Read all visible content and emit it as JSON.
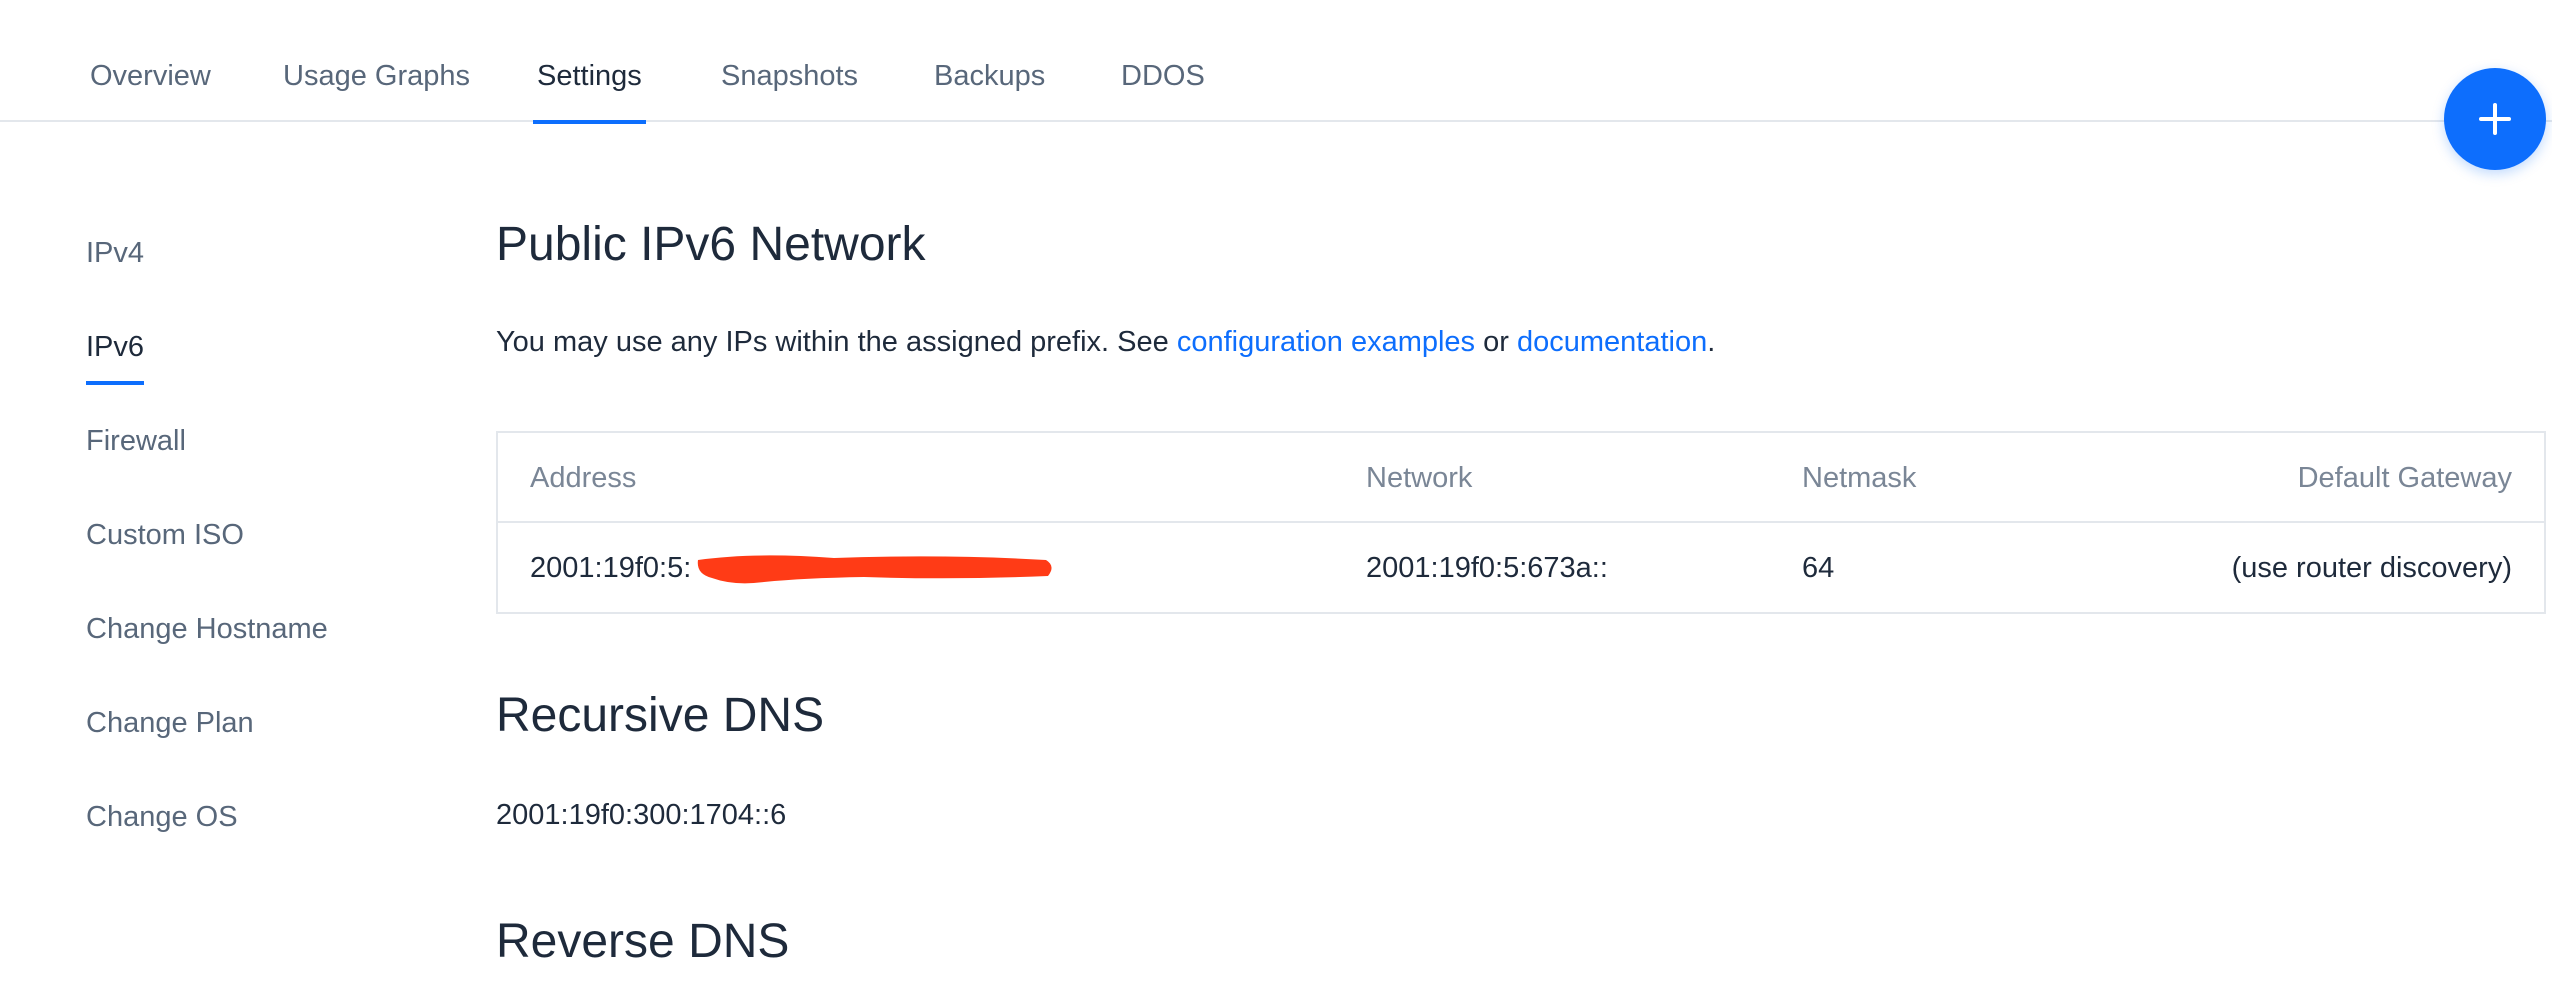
{
  "tabs": [
    {
      "label": "Overview"
    },
    {
      "label": "Usage Graphs"
    },
    {
      "label": "Settings",
      "active": true
    },
    {
      "label": "Snapshots"
    },
    {
      "label": "Backups"
    },
    {
      "label": "DDOS"
    }
  ],
  "fab": {
    "icon": "plus-icon"
  },
  "sidenav": [
    {
      "label": "IPv4"
    },
    {
      "label": "IPv6",
      "active": true
    },
    {
      "label": "Firewall"
    },
    {
      "label": "Custom ISO"
    },
    {
      "label": "Change Hostname"
    },
    {
      "label": "Change Plan"
    },
    {
      "label": "Change OS"
    }
  ],
  "ipv6": {
    "title": "Public IPv6 Network",
    "intro_text": "You may use any IPs within the assigned prefix. See ",
    "link_config": "configuration examples",
    "intro_or": " or ",
    "link_docs": "documentation",
    "intro_end": ".",
    "table": {
      "headers": [
        "Address",
        "Network",
        "Netmask",
        "Default Gateway"
      ],
      "row": {
        "address": "2001:19f0:5:",
        "network": "2001:19f0:5:673a::",
        "netmask": "64",
        "gateway": "(use router discovery)"
      }
    }
  },
  "recursive_dns": {
    "title": "Recursive DNS",
    "value": "2001:19f0:300:1704::6"
  },
  "reverse_dns": {
    "title": "Reverse DNS"
  },
  "colors": {
    "accent": "#0d6efd",
    "redaction": "#ff3b16",
    "text": "#1e2a3b",
    "muted": "#58677a",
    "border": "#e3e7ec"
  }
}
